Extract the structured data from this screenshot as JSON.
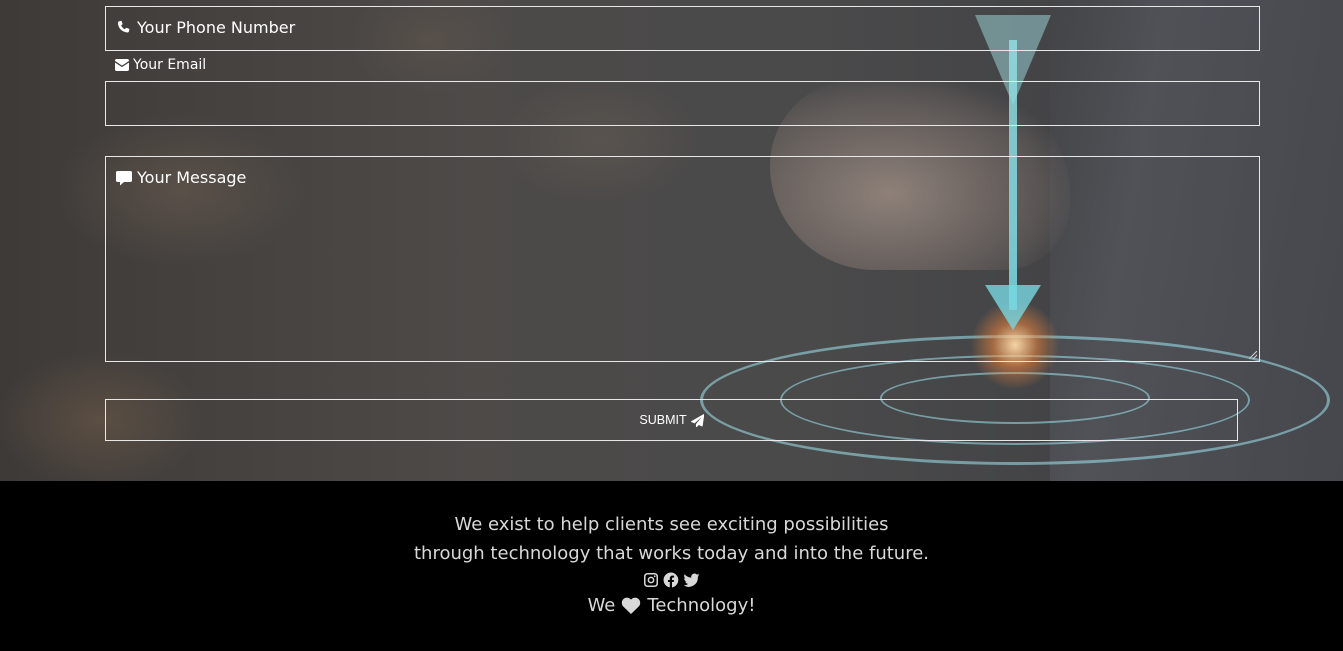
{
  "form": {
    "phone_placeholder": "Your Phone Number",
    "email_label": "Your Email",
    "message_placeholder": "Your Message",
    "submit_label": "SUBMIT"
  },
  "icons": {
    "phone": "phone-icon",
    "email": "envelope-icon",
    "message": "comment-icon",
    "submit": "paper-plane-icon",
    "social": [
      "instagram-icon",
      "facebook-icon",
      "twitter-icon"
    ],
    "heart": "heart-icon"
  },
  "footer": {
    "line1": "We exist to help clients see exciting possibilities",
    "line2": "through technology that works today and into the future.",
    "love_prefix": "We",
    "love_suffix": "Technology!"
  },
  "colors": {
    "footer_bg": "#000000",
    "border": "#e8e8e8",
    "footer_text": "#d8d8d8"
  }
}
